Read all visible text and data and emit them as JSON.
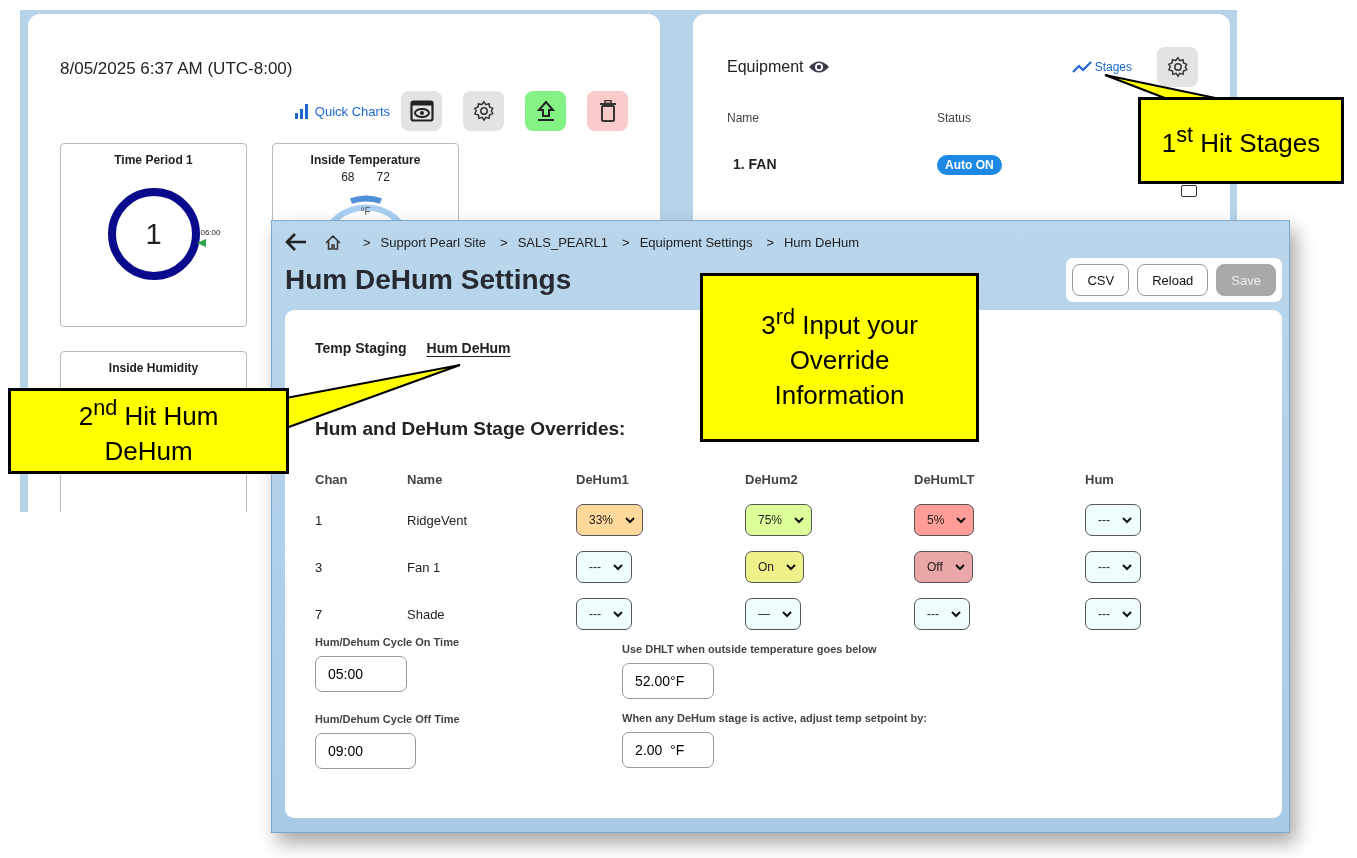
{
  "dashboard": {
    "datetime": "8/05/2025 6:37 AM (UTC-8:00)",
    "quick_charts": "Quick Charts",
    "cards": [
      {
        "kind": "ring",
        "title": "Time Period 1",
        "value": "1",
        "marker": "06:00"
      },
      {
        "kind": "gauge",
        "title": "Inside Temperature",
        "low": "68",
        "high": "72",
        "unit": "°F"
      },
      {
        "kind": "plain",
        "title": "Inside Humidity"
      }
    ]
  },
  "equipment": {
    "title": "Equipment",
    "stages_link": "Stages",
    "columns": [
      "Name",
      "Status"
    ],
    "rows": [
      {
        "name": "1. FAN",
        "status": "Auto ON"
      }
    ]
  },
  "settings_window": {
    "breadcrumb_separator": ">",
    "breadcrumb": [
      "Support Pearl Site",
      "SALS_PEARL1",
      "Equipment Settings",
      "Hum DeHum"
    ],
    "title": "Hum DeHum Settings",
    "buttons": [
      {
        "label": "CSV",
        "disabled": false
      },
      {
        "label": "Reload",
        "disabled": false
      },
      {
        "label": "Save",
        "disabled": true
      }
    ],
    "tabs": [
      {
        "label": "Temp Staging",
        "selected": false
      },
      {
        "label": "Hum DeHum",
        "selected": true
      }
    ],
    "section_title": "Hum and DeHum Stage Overrides:",
    "columns": [
      "Chan",
      "Name",
      "DeHum1",
      "DeHum2",
      "DeHumLT",
      "Hum"
    ],
    "rows": [
      {
        "chan": "1",
        "name": "RidgeVent",
        "stages": [
          {
            "value": "33%",
            "color": "#ffd89b"
          },
          {
            "value": "75%",
            "color": "#ddff99"
          },
          {
            "value": "5%",
            "color": "#ff9e98"
          },
          {
            "value": "---",
            "color": "#eefeff"
          }
        ]
      },
      {
        "chan": "3",
        "name": "Fan 1",
        "stages": [
          {
            "value": "---",
            "color": "#eefeff"
          },
          {
            "value": "On",
            "color": "#eef08a"
          },
          {
            "value": "Off",
            "color": "#eba7a7"
          },
          {
            "value": "---",
            "color": "#eefeff"
          }
        ]
      },
      {
        "chan": "7",
        "name": "Shade",
        "stages": [
          {
            "value": "---",
            "color": "#eefeff"
          },
          {
            "value": "—",
            "color": "#eefeff"
          },
          {
            "value": "---",
            "color": "#eefeff"
          },
          {
            "value": "---",
            "color": "#eefeff"
          }
        ]
      }
    ],
    "cycle_fields": [
      {
        "label": "Hum/Dehum Cycle On Time",
        "value": "05:00"
      },
      {
        "label": "Hum/Dehum Cycle Off Time",
        "value": "09:00"
      }
    ],
    "temp_fields": [
      {
        "label": "Use DHLT when outside temperature goes below",
        "value": "52.00°F"
      },
      {
        "label": "When any DeHum stage is active, adjust temp setpoint by:",
        "value": "2.00  °F"
      }
    ]
  },
  "callouts": [
    {
      "text": "1$^{st}$ Hit Stages"
    },
    {
      "text": "2$^{nd}$ Hit Hum DeHum"
    },
    {
      "text": "3$^{rd}$ Input your Override Information"
    }
  ]
}
